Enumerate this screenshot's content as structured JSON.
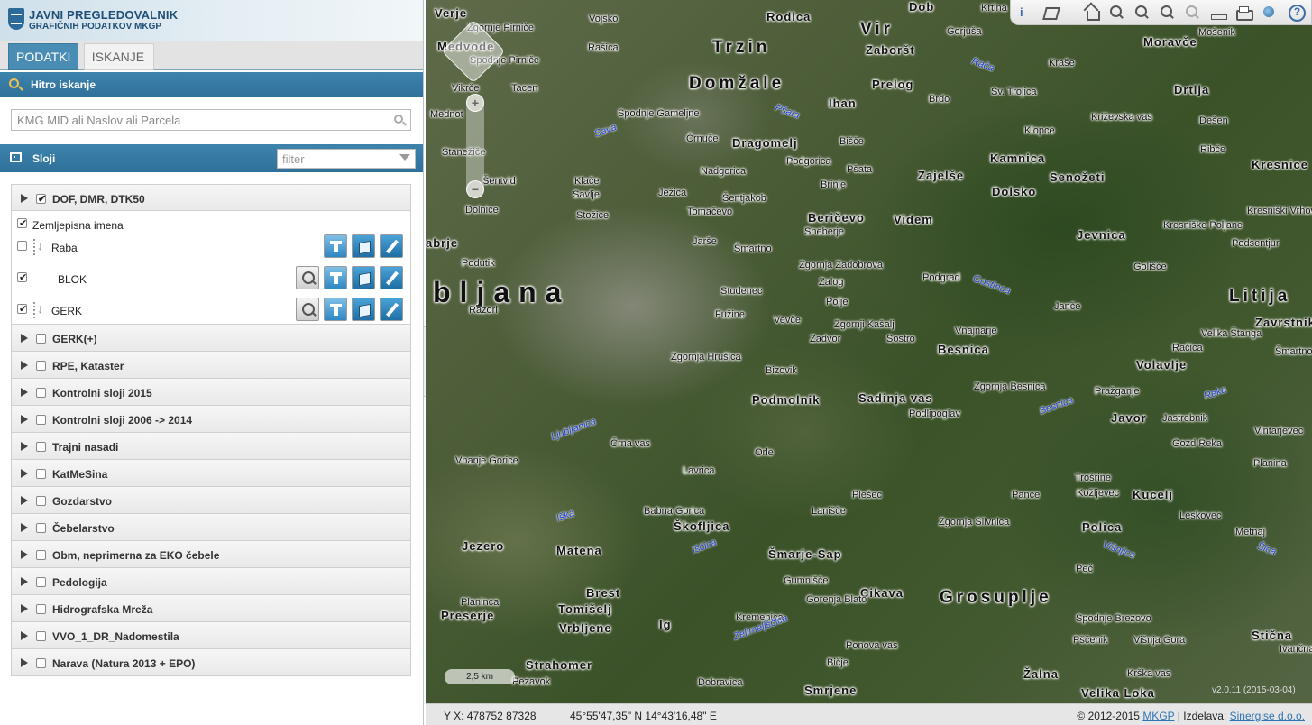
{
  "header": {
    "title_line1": "JAVNI PREGLEDOVALNIK",
    "title_line2": "GRAFIČNIH PODATKOV MKGP"
  },
  "tabs": [
    {
      "label": "PODATKI",
      "active": true
    },
    {
      "label": "ISKANJE",
      "active": false
    }
  ],
  "quick_search": {
    "title": "Hitro iskanje",
    "placeholder": "KMG MID ali Naslov ali Parcela"
  },
  "layers": {
    "title": "Sloji",
    "filter_placeholder": "filter",
    "expanded_group": {
      "label": "DOF, DMR, DTK50",
      "checked": true,
      "items": [
        {
          "label": "Zemljepisna imena",
          "checked": true
        },
        {
          "label": "Raba",
          "checked": false
        },
        {
          "label": "BLOK",
          "checked": true
        },
        {
          "label": "GERK",
          "checked": true
        }
      ]
    },
    "groups": [
      {
        "label": "GERK(+)",
        "checked": false
      },
      {
        "label": "RPE, Kataster",
        "checked": false
      },
      {
        "label": "Kontrolni sloji 2015",
        "checked": false
      },
      {
        "label": "Kontrolni sloji 2006 -> 2014",
        "checked": false
      },
      {
        "label": "Trajni nasadi",
        "checked": false
      },
      {
        "label": "KatMeSina",
        "checked": false
      },
      {
        "label": "Gozdarstvo",
        "checked": false
      },
      {
        "label": "Čebelarstvo",
        "checked": false
      },
      {
        "label": "Obm, neprimerna za EKO čebele",
        "checked": false
      },
      {
        "label": "Pedologija",
        "checked": false
      },
      {
        "label": "Hidrografska Mreža",
        "checked": false
      },
      {
        "label": "VVO_1_DR_Nadomestila",
        "checked": false
      },
      {
        "label": "Narava (Natura 2013 + EPO)",
        "checked": false
      }
    ]
  },
  "map": {
    "zoom_in": "+",
    "zoom_out": "−",
    "scale": "2,5 km",
    "version": "v2.0.11 (2015-03-04)",
    "labels": [
      {
        "text": "Verje",
        "size": "m"
      },
      {
        "text": "Zgornje Pirniče",
        "size": "s"
      },
      {
        "text": "Medvode",
        "size": "m"
      },
      {
        "text": "Spodnje Pirniče",
        "size": "s"
      },
      {
        "text": "Vojsko",
        "size": "s"
      },
      {
        "text": "Rašica",
        "size": "s"
      },
      {
        "text": "Rodica",
        "size": "m"
      },
      {
        "text": "Trzin",
        "size": "b"
      },
      {
        "text": "Vir",
        "size": "b"
      },
      {
        "text": "Zaboršt",
        "size": "m"
      },
      {
        "text": "Dob",
        "size": "m"
      },
      {
        "text": "Gorjuša",
        "size": "s"
      },
      {
        "text": "Krtina",
        "size": "s"
      },
      {
        "text": "Moravče",
        "size": "m"
      },
      {
        "text": "Mošenik",
        "size": "s"
      },
      {
        "text": "Rača",
        "size": "w"
      },
      {
        "text": "Kraše",
        "size": "s"
      },
      {
        "text": "Vikrče",
        "size": "s"
      },
      {
        "text": "Tacen",
        "size": "s"
      },
      {
        "text": "Domžale",
        "size": "b"
      },
      {
        "text": "Prelog",
        "size": "m"
      },
      {
        "text": "Brdo",
        "size": "s"
      },
      {
        "text": "Sv. Trojica",
        "size": "s"
      },
      {
        "text": "Drtija",
        "size": "m"
      },
      {
        "text": "Ihan",
        "size": "m"
      },
      {
        "text": "Pšata",
        "size": "w"
      },
      {
        "text": "Mednot",
        "size": "s"
      },
      {
        "text": "Spodnje Gameljne",
        "size": "s"
      },
      {
        "text": "Sava",
        "size": "w"
      },
      {
        "text": "Črnuče",
        "size": "s"
      },
      {
        "text": "Dragomelj",
        "size": "m"
      },
      {
        "text": "Podgorica",
        "size": "s"
      },
      {
        "text": "Bišče",
        "size": "s"
      },
      {
        "text": "Klopce",
        "size": "s"
      },
      {
        "text": "Križevska vas",
        "size": "s"
      },
      {
        "text": "Dešen",
        "size": "s"
      },
      {
        "text": "Ribče",
        "size": "s"
      },
      {
        "text": "Stanežiče",
        "size": "s"
      },
      {
        "text": "Šentvid",
        "size": "s"
      },
      {
        "text": "Kamnica",
        "size": "m"
      },
      {
        "text": "Kresnice",
        "size": "m"
      },
      {
        "text": "Pšata",
        "size": "s"
      },
      {
        "text": "Zajelše",
        "size": "m"
      },
      {
        "text": "Senožeti",
        "size": "m"
      },
      {
        "text": "Nadgorica",
        "size": "s"
      },
      {
        "text": "Dolsko",
        "size": "m"
      },
      {
        "text": "Klače",
        "size": "s"
      },
      {
        "text": "Savlje",
        "size": "s"
      },
      {
        "text": "Ježica",
        "size": "s"
      },
      {
        "text": "Šentjakob",
        "size": "s"
      },
      {
        "text": "Brinje",
        "size": "s"
      },
      {
        "text": "Dolnice",
        "size": "s"
      },
      {
        "text": "Tomačevo",
        "size": "s"
      },
      {
        "text": "Beričevo",
        "size": "m"
      },
      {
        "text": "Videm",
        "size": "m"
      },
      {
        "text": "Stožice",
        "size": "s"
      },
      {
        "text": "Sneberje",
        "size": "s"
      },
      {
        "text": "Kresniške Poljane",
        "size": "s"
      },
      {
        "text": "Kresniški Vrhovi",
        "size": "s"
      },
      {
        "text": "Jevnica",
        "size": "m"
      },
      {
        "text": "Podsentjur",
        "size": "s"
      },
      {
        "text": "Jarše",
        "size": "s"
      },
      {
        "text": "Šmartno",
        "size": "s"
      },
      {
        "text": "Zgornja Zadobrova",
        "size": "s"
      },
      {
        "text": "Golišče",
        "size": "s"
      },
      {
        "text": "abrje",
        "size": "m"
      },
      {
        "text": "Podutik",
        "size": "s"
      },
      {
        "text": "Zalog",
        "size": "s"
      },
      {
        "text": "Podgrad",
        "size": "s"
      },
      {
        "text": "Gostinca",
        "size": "w"
      },
      {
        "text": "bljana",
        "size": "xl"
      },
      {
        "text": "Studenec",
        "size": "s"
      },
      {
        "text": "Litija",
        "size": "b"
      },
      {
        "text": "Razori",
        "size": "s"
      },
      {
        "text": "Polje",
        "size": "s"
      },
      {
        "text": "Janče",
        "size": "s"
      },
      {
        "text": "Fužine",
        "size": "s"
      },
      {
        "text": "Vevče",
        "size": "s"
      },
      {
        "text": "Zgornji Kašalj",
        "size": "s"
      },
      {
        "text": "Vnajnarje",
        "size": "s"
      },
      {
        "text": "Zavrstnik",
        "size": "m"
      },
      {
        "text": "Zadvor",
        "size": "s"
      },
      {
        "text": "Sostro",
        "size": "s"
      },
      {
        "text": "Besnica",
        "size": "m"
      },
      {
        "text": "Velika Štanga",
        "size": "s"
      },
      {
        "text": "Račica",
        "size": "s"
      },
      {
        "text": "Šmartno",
        "size": "s"
      },
      {
        "text": "Zgornja Hrušica",
        "size": "s"
      },
      {
        "text": "Volavlje",
        "size": "m"
      },
      {
        "text": "Bizovik",
        "size": "s"
      },
      {
        "text": "Zgornja Besnica",
        "size": "s"
      },
      {
        "text": "Pražganje",
        "size": "s"
      },
      {
        "text": "Reka",
        "size": "w"
      },
      {
        "text": "Podmolnik",
        "size": "m"
      },
      {
        "text": "Sadinja vas",
        "size": "m"
      },
      {
        "text": "Javor",
        "size": "m"
      },
      {
        "text": "Besnica",
        "size": "w"
      },
      {
        "text": "Podlipoglav",
        "size": "s"
      },
      {
        "text": "Jastrebnik",
        "size": "s"
      },
      {
        "text": "Vintarjevec",
        "size": "s"
      },
      {
        "text": "Ljubljanica",
        "size": "w"
      },
      {
        "text": "Črna vas",
        "size": "s"
      },
      {
        "text": "Gozd Reka",
        "size": "s"
      },
      {
        "text": "Orle",
        "size": "s"
      },
      {
        "text": "Vnanje Gorice",
        "size": "s"
      },
      {
        "text": "Lavrica",
        "size": "s"
      },
      {
        "text": "Trošrine",
        "size": "s"
      },
      {
        "text": "Planina",
        "size": "s"
      },
      {
        "text": "Plešec",
        "size": "s"
      },
      {
        "text": "Pance",
        "size": "s"
      },
      {
        "text": "Kožljevec",
        "size": "s"
      },
      {
        "text": "Kucelj",
        "size": "m"
      },
      {
        "text": "Lanišče",
        "size": "s"
      },
      {
        "text": "Babna Gorica",
        "size": "s"
      },
      {
        "text": "Iška",
        "size": "w"
      },
      {
        "text": "Leskovec",
        "size": "s"
      },
      {
        "text": "Škofljica",
        "size": "m"
      },
      {
        "text": "Zgornja Slivnica",
        "size": "s"
      },
      {
        "text": "Polica",
        "size": "m"
      },
      {
        "text": "Metnaj",
        "size": "s"
      },
      {
        "text": "Jezero",
        "size": "m"
      },
      {
        "text": "Matena",
        "size": "m"
      },
      {
        "text": "Šmarje-Sap",
        "size": "m"
      },
      {
        "text": "Višnjica",
        "size": "w"
      },
      {
        "text": "Iščica",
        "size": "w"
      },
      {
        "text": "Šica",
        "size": "w"
      },
      {
        "text": "Gumnišče",
        "size": "s"
      },
      {
        "text": "Peč",
        "size": "s"
      },
      {
        "text": "Brest",
        "size": "m"
      },
      {
        "text": "Cikava",
        "size": "m"
      },
      {
        "text": "Grosuplje",
        "size": "b"
      },
      {
        "text": "Planinca",
        "size": "s"
      },
      {
        "text": "Gorenja Blato",
        "size": "s"
      },
      {
        "text": "Tomišelj",
        "size": "m"
      },
      {
        "text": "Preserje",
        "size": "m"
      },
      {
        "text": "Kremenica",
        "size": "s"
      },
      {
        "text": "Spodnje Brezovo",
        "size": "s"
      },
      {
        "text": "Vrbljene",
        "size": "m"
      },
      {
        "text": "Ig",
        "size": "m"
      },
      {
        "text": "Stična",
        "size": "m"
      },
      {
        "text": "Pščenik",
        "size": "s"
      },
      {
        "text": "Višnja Gora",
        "size": "s"
      },
      {
        "text": "Ponova vas",
        "size": "s"
      },
      {
        "text": "Ivančna",
        "size": "s"
      },
      {
        "text": "Strahomer",
        "size": "m"
      },
      {
        "text": "Bičje",
        "size": "s"
      },
      {
        "text": "Krška vas",
        "size": "s"
      },
      {
        "text": "Žalna",
        "size": "m"
      },
      {
        "text": "Zelimeljščica",
        "size": "w"
      },
      {
        "text": "Dobravica",
        "size": "s"
      },
      {
        "text": "Smrjene",
        "size": "m"
      },
      {
        "text": "Velika Loka",
        "size": "m"
      },
      {
        "text": "Pezavok",
        "size": "s"
      }
    ]
  },
  "status": {
    "yx": "Y X: 478752 87328",
    "latlon": "45°55'47,35\" N 14°43'16,48\" E",
    "copyright": "© 2012-2015",
    "link1": "MKGP",
    "sep": "| Izdelava:",
    "link2": "Sinergise d.o.o."
  }
}
